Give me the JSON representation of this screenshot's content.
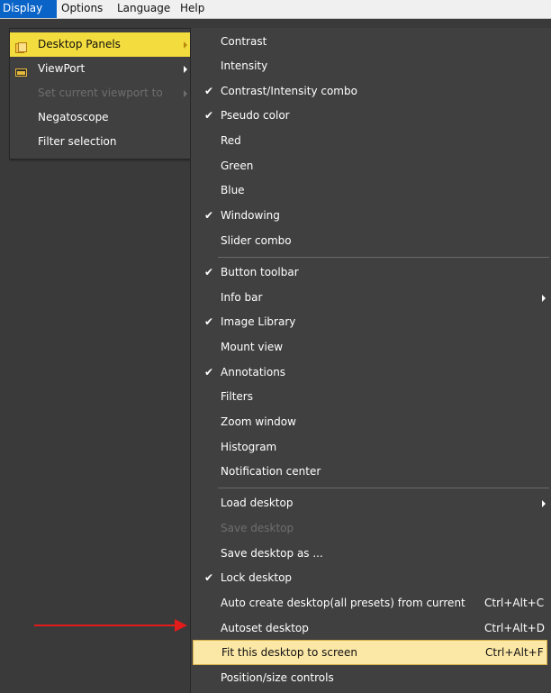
{
  "menubar": {
    "items": [
      "Display",
      "Options",
      "Language",
      "Help"
    ],
    "active": "Display"
  },
  "display_menu": {
    "items": [
      {
        "label": "Desktop Panels",
        "icon": "panels-icon",
        "submenu": true,
        "highlighted": true
      },
      {
        "label": "ViewPort",
        "icon": "viewport-icon",
        "submenu": true
      },
      {
        "label": "Set current viewport to",
        "disabled": true,
        "submenu": true
      },
      {
        "label": "Negatoscope"
      },
      {
        "label": "Filter selection"
      }
    ]
  },
  "desktop_panels_menu": {
    "items": [
      {
        "label": "Contrast",
        "checked": false
      },
      {
        "label": "Intensity",
        "checked": false
      },
      {
        "label": "Contrast/Intensity combo",
        "checked": true
      },
      {
        "label": "Pseudo color",
        "checked": true
      },
      {
        "label": "Red",
        "checked": false
      },
      {
        "label": "Green",
        "checked": false
      },
      {
        "label": "Blue",
        "checked": false
      },
      {
        "label": "Windowing",
        "checked": true
      },
      {
        "label": "Slider combo",
        "checked": false
      },
      {
        "label": "Button toolbar",
        "checked": true
      },
      {
        "label": "Info bar",
        "checked": false,
        "submenu": true
      },
      {
        "label": "Image Library",
        "checked": true
      },
      {
        "label": "Mount view",
        "checked": false
      },
      {
        "label": "Annotations",
        "checked": true
      },
      {
        "label": "Filters",
        "checked": false
      },
      {
        "label": "Zoom window",
        "checked": false
      },
      {
        "label": "Histogram",
        "checked": false
      },
      {
        "label": "Notification center",
        "checked": false
      },
      {
        "label": "Load desktop",
        "checked": false,
        "submenu": true
      },
      {
        "label": "Save desktop",
        "disabled": true
      },
      {
        "label": "Save desktop as ...",
        "checked": false
      },
      {
        "label": "Lock desktop",
        "checked": true
      },
      {
        "label": "Auto create desktop(all presets) from current",
        "shortcut": "Ctrl+Alt+C"
      },
      {
        "label": "Autoset desktop",
        "shortcut": "Ctrl+Alt+D"
      },
      {
        "label": "Fit this desktop to screen",
        "shortcut": "Ctrl+Alt+F",
        "highlighted": true
      },
      {
        "label": "Position/size controls"
      }
    ],
    "check_glyph": "✔"
  },
  "colors": {
    "menu_bg": "#404040",
    "highlight_yellow": "#f3dc3d",
    "hover_item": "#fbe7a6",
    "annotation_arrow": "#e21b1b",
    "menubar_active": "#0a64c8"
  }
}
